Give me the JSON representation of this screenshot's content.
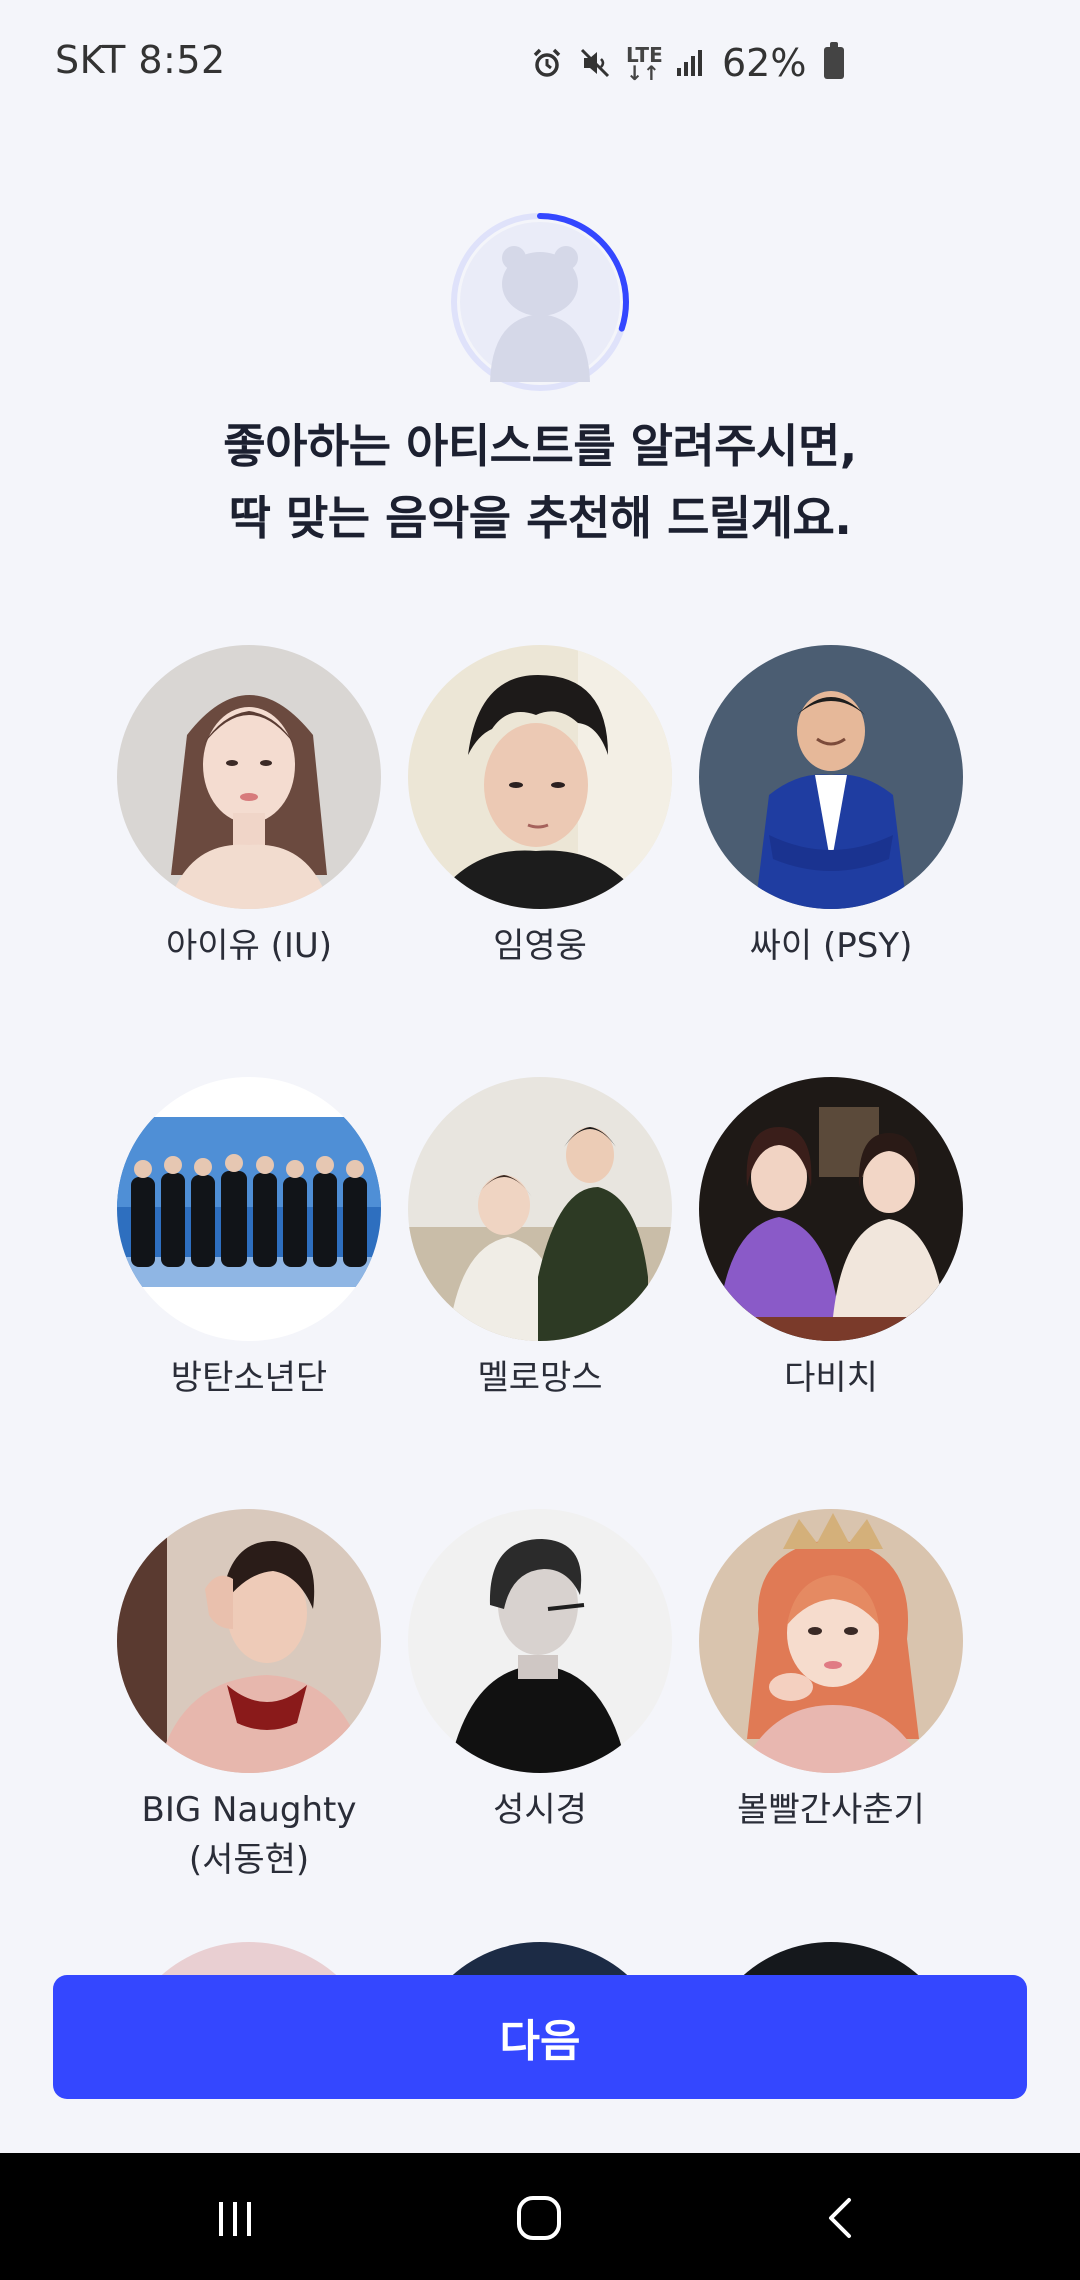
{
  "status_bar": {
    "carrier_time": "SKT 8:52",
    "network": "LTE",
    "battery": "62%",
    "icons": [
      "alarm-icon",
      "mute-icon",
      "lte-icon",
      "signal-icon",
      "battery-icon"
    ]
  },
  "onboarding": {
    "progress_fraction": 0.3,
    "accent_color": "#3447ff",
    "headline_line1": "좋아하는 아티스트를 알려주시면,",
    "headline_line2": "딱 맞는 음악을 추천해 드릴게요."
  },
  "artists": [
    {
      "name": "아이유 (IU)"
    },
    {
      "name": "임영웅"
    },
    {
      "name": "싸이 (PSY)"
    },
    {
      "name": "방탄소년단"
    },
    {
      "name": "멜로망스"
    },
    {
      "name": "다비치"
    },
    {
      "name": "BIG Naughty\n(서동현)"
    },
    {
      "name": "성시경"
    },
    {
      "name": "볼빨간사춘기"
    }
  ],
  "next_button": {
    "label": "다음",
    "color": "#3447ff"
  },
  "nav_bar": {
    "icons": [
      "recent-apps-icon",
      "home-icon",
      "back-icon"
    ]
  }
}
